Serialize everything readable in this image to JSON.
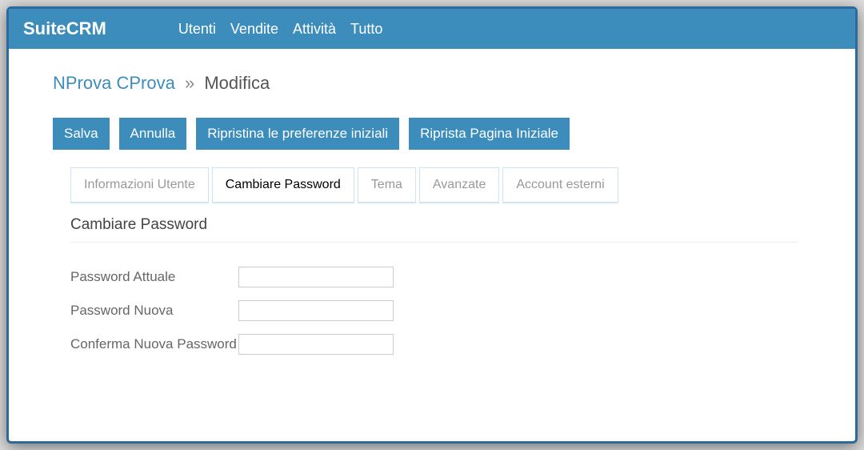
{
  "brand": "SuiteCRM",
  "topnav": {
    "items": [
      "Utenti",
      "Vendite",
      "Attività",
      "Tutto"
    ]
  },
  "breadcrumb": {
    "link": "NProva CProva",
    "sep": "»",
    "current": "Modifica"
  },
  "actions": {
    "save": "Salva",
    "cancel": "Annulla",
    "reset_prefs": "Ripristina le preferenze iniziali",
    "reset_home": "Riprista Pagina Iniziale"
  },
  "tabs": [
    {
      "label": "Informazioni Utente",
      "active": false
    },
    {
      "label": "Cambiare Password",
      "active": true
    },
    {
      "label": "Tema",
      "active": false
    },
    {
      "label": "Avanzate",
      "active": false
    },
    {
      "label": "Account esterni",
      "active": false
    }
  ],
  "section_title": "Cambiare Password",
  "form": {
    "current_pw_label": "Password Attuale",
    "new_pw_label": "Password Nuova",
    "confirm_pw_label": "Conferma Nuova Password",
    "current_pw_value": "",
    "new_pw_value": "",
    "confirm_pw_value": ""
  }
}
